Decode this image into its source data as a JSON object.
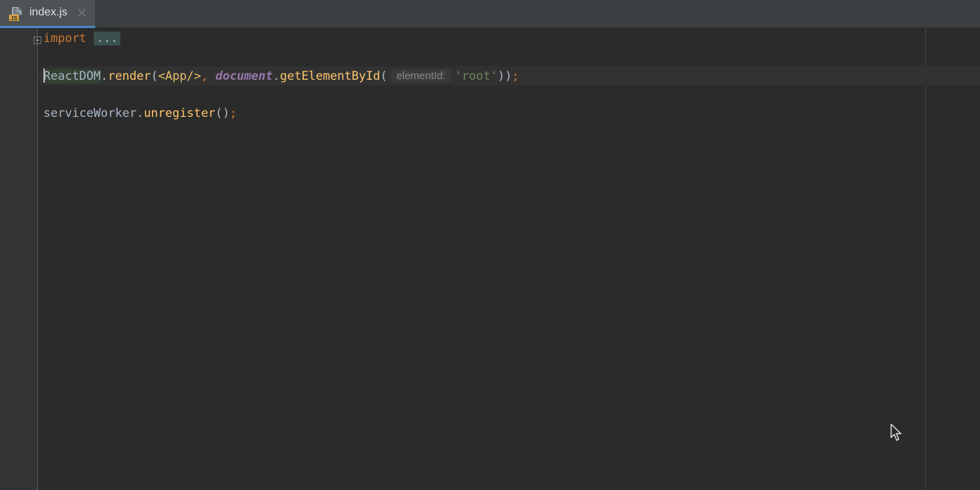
{
  "tab": {
    "filename": "index.js",
    "icon": "js-file-icon",
    "icon_badge": "JS"
  },
  "editor": {
    "line1": {
      "keyword": "import",
      "folded": "..."
    },
    "line2": {
      "object": "ReactDOM",
      "dot1": ".",
      "method": "render",
      "open": "(",
      "jsx": "<App/>",
      "comma": ", ",
      "global": "document",
      "dot2": ".",
      "call": "getElementById",
      "open2": "(",
      "param_hint": "elementId:",
      "arg": "'root'",
      "close": "))",
      "semi": ";"
    },
    "line3": {
      "object": "serviceWorker",
      "dot": ".",
      "method": "unregister",
      "parens": "()",
      "semi": ";"
    }
  },
  "colors": {
    "background": "#2b2b2b",
    "gutter": "#313335",
    "tab_active_underline": "#4a88c7",
    "keyword": "#cc7832",
    "function": "#ffc66d",
    "string": "#6a8759",
    "global": "#9876aa"
  }
}
